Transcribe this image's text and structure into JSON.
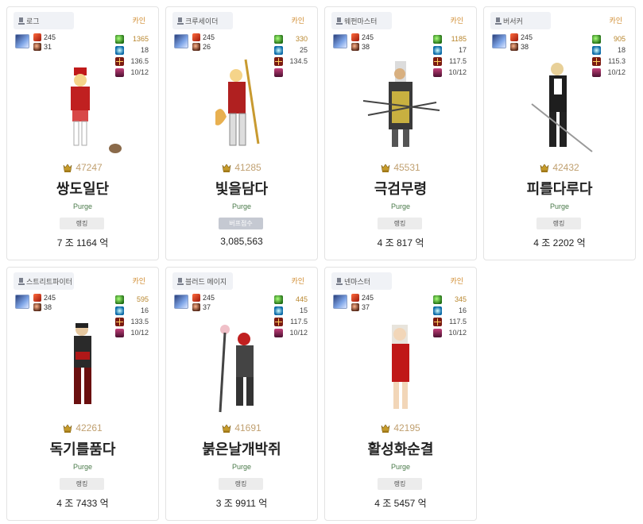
{
  "cards": [
    {
      "job": "로그",
      "server": "카인",
      "level": "245",
      "pet_level": "31",
      "stats": [
        "1365",
        "18",
        "136.5",
        "10/12"
      ],
      "fame": "47247",
      "name": "쌍도일단",
      "guild": "Purge",
      "badge": "랭킹",
      "value": "7 조 1164 억",
      "badge_style": "light"
    },
    {
      "job": "크루세이더",
      "server": "카인",
      "level": "245",
      "pet_level": "26",
      "stats": [
        "330",
        "25",
        "134.5",
        ""
      ],
      "fame": "41285",
      "name": "빛을담다",
      "guild": "Purge",
      "badge": "버프점수",
      "value": "3,085,563",
      "badge_style": "dark"
    },
    {
      "job": "웨펀마스터",
      "server": "카인",
      "level": "245",
      "pet_level": "38",
      "stats": [
        "1185",
        "17",
        "117.5",
        "10/12"
      ],
      "fame": "45531",
      "name": "극검무령",
      "guild": "Purge",
      "badge": "랭킹",
      "value": "4 조 817 억",
      "badge_style": "light"
    },
    {
      "job": "버서커",
      "server": "카인",
      "level": "245",
      "pet_level": "38",
      "stats": [
        "905",
        "18",
        "115.3",
        "10/12"
      ],
      "fame": "42432",
      "name": "피를다루다",
      "guild": "Purge",
      "badge": "랭킹",
      "value": "4 조 2202 억",
      "badge_style": "light"
    },
    {
      "job": "스트리트파이터",
      "server": "카인",
      "level": "245",
      "pet_level": "38",
      "stats": [
        "595",
        "16",
        "133.5",
        "10/12"
      ],
      "fame": "42261",
      "name": "독기를품다",
      "guild": "Purge",
      "badge": "랭킹",
      "value": "4 조 7433 억",
      "badge_style": "light"
    },
    {
      "job": "블러드 메이지",
      "server": "카인",
      "level": "245",
      "pet_level": "37",
      "stats": [
        "445",
        "15",
        "117.5",
        "10/12"
      ],
      "fame": "41691",
      "name": "붉은날개박쥐",
      "guild": "Purge",
      "badge": "랭킹",
      "value": "3 조 9911 억",
      "badge_style": "light"
    },
    {
      "job": "넨마스터",
      "server": "카인",
      "level": "245",
      "pet_level": "37",
      "stats": [
        "345",
        "16",
        "117.5",
        "10/12"
      ],
      "fame": "42195",
      "name": "활성화순결",
      "guild": "Purge",
      "badge": "랭킹",
      "value": "4 조 5457 억",
      "badge_style": "light"
    }
  ],
  "colors": {
    "server": "#d08a2c",
    "fame": "#c0a070",
    "guild": "#4a7a4a"
  }
}
